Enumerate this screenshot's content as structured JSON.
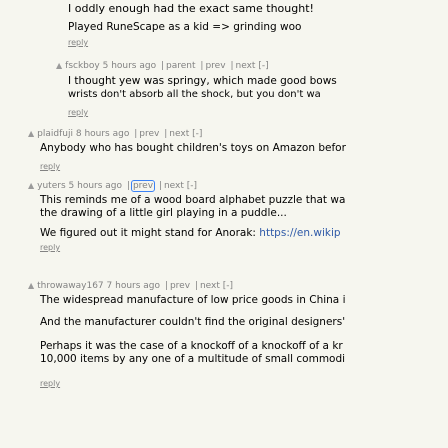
{
  "comments": [
    {
      "lines": [
        "I oddly enough had the exact same thought!",
        "Played RuneScape as a kid => grinding woo"
      ],
      "reply": "reply"
    },
    {
      "user": "fsckboy",
      "age": "5 hours ago",
      "links": [
        "parent",
        "prev",
        "next",
        "[-]"
      ],
      "lines": [
        "I thought yew was springy, which made good bows",
        "wrists don't absorb all the shock, but you don't wa"
      ],
      "reply": "reply"
    },
    {
      "user": "plaidfuji",
      "age": "8 hours ago",
      "links": [
        "prev",
        "next",
        "[-]"
      ],
      "lines": [
        "Anybody who has bought children's toys on Amazon befor"
      ],
      "reply": "reply"
    },
    {
      "user": "yuters",
      "age": "5 hours ago",
      "links": [
        "prev",
        "next",
        "[-]"
      ],
      "lines": [
        "This reminds me of a wood board alphabet puzzle that wa",
        "the drawing of a little girl playing in a puddle...",
        "We figured out it might stand for Anorak: "
      ],
      "url": "https://en.wikip",
      "reply": "reply"
    },
    {
      "user": "throwaway167",
      "age": "7 hours ago",
      "links": [
        "prev",
        "next",
        "[-]"
      ],
      "lines": [
        "The widespread manufacture of low price goods in China i",
        "And the manufacturer couldn't find the original designers'",
        "Perhaps it was the case of a knockoff of a knockoff of a kr",
        "10,000 items by any one of a multitude of small commodi"
      ],
      "reply": "reply"
    }
  ]
}
